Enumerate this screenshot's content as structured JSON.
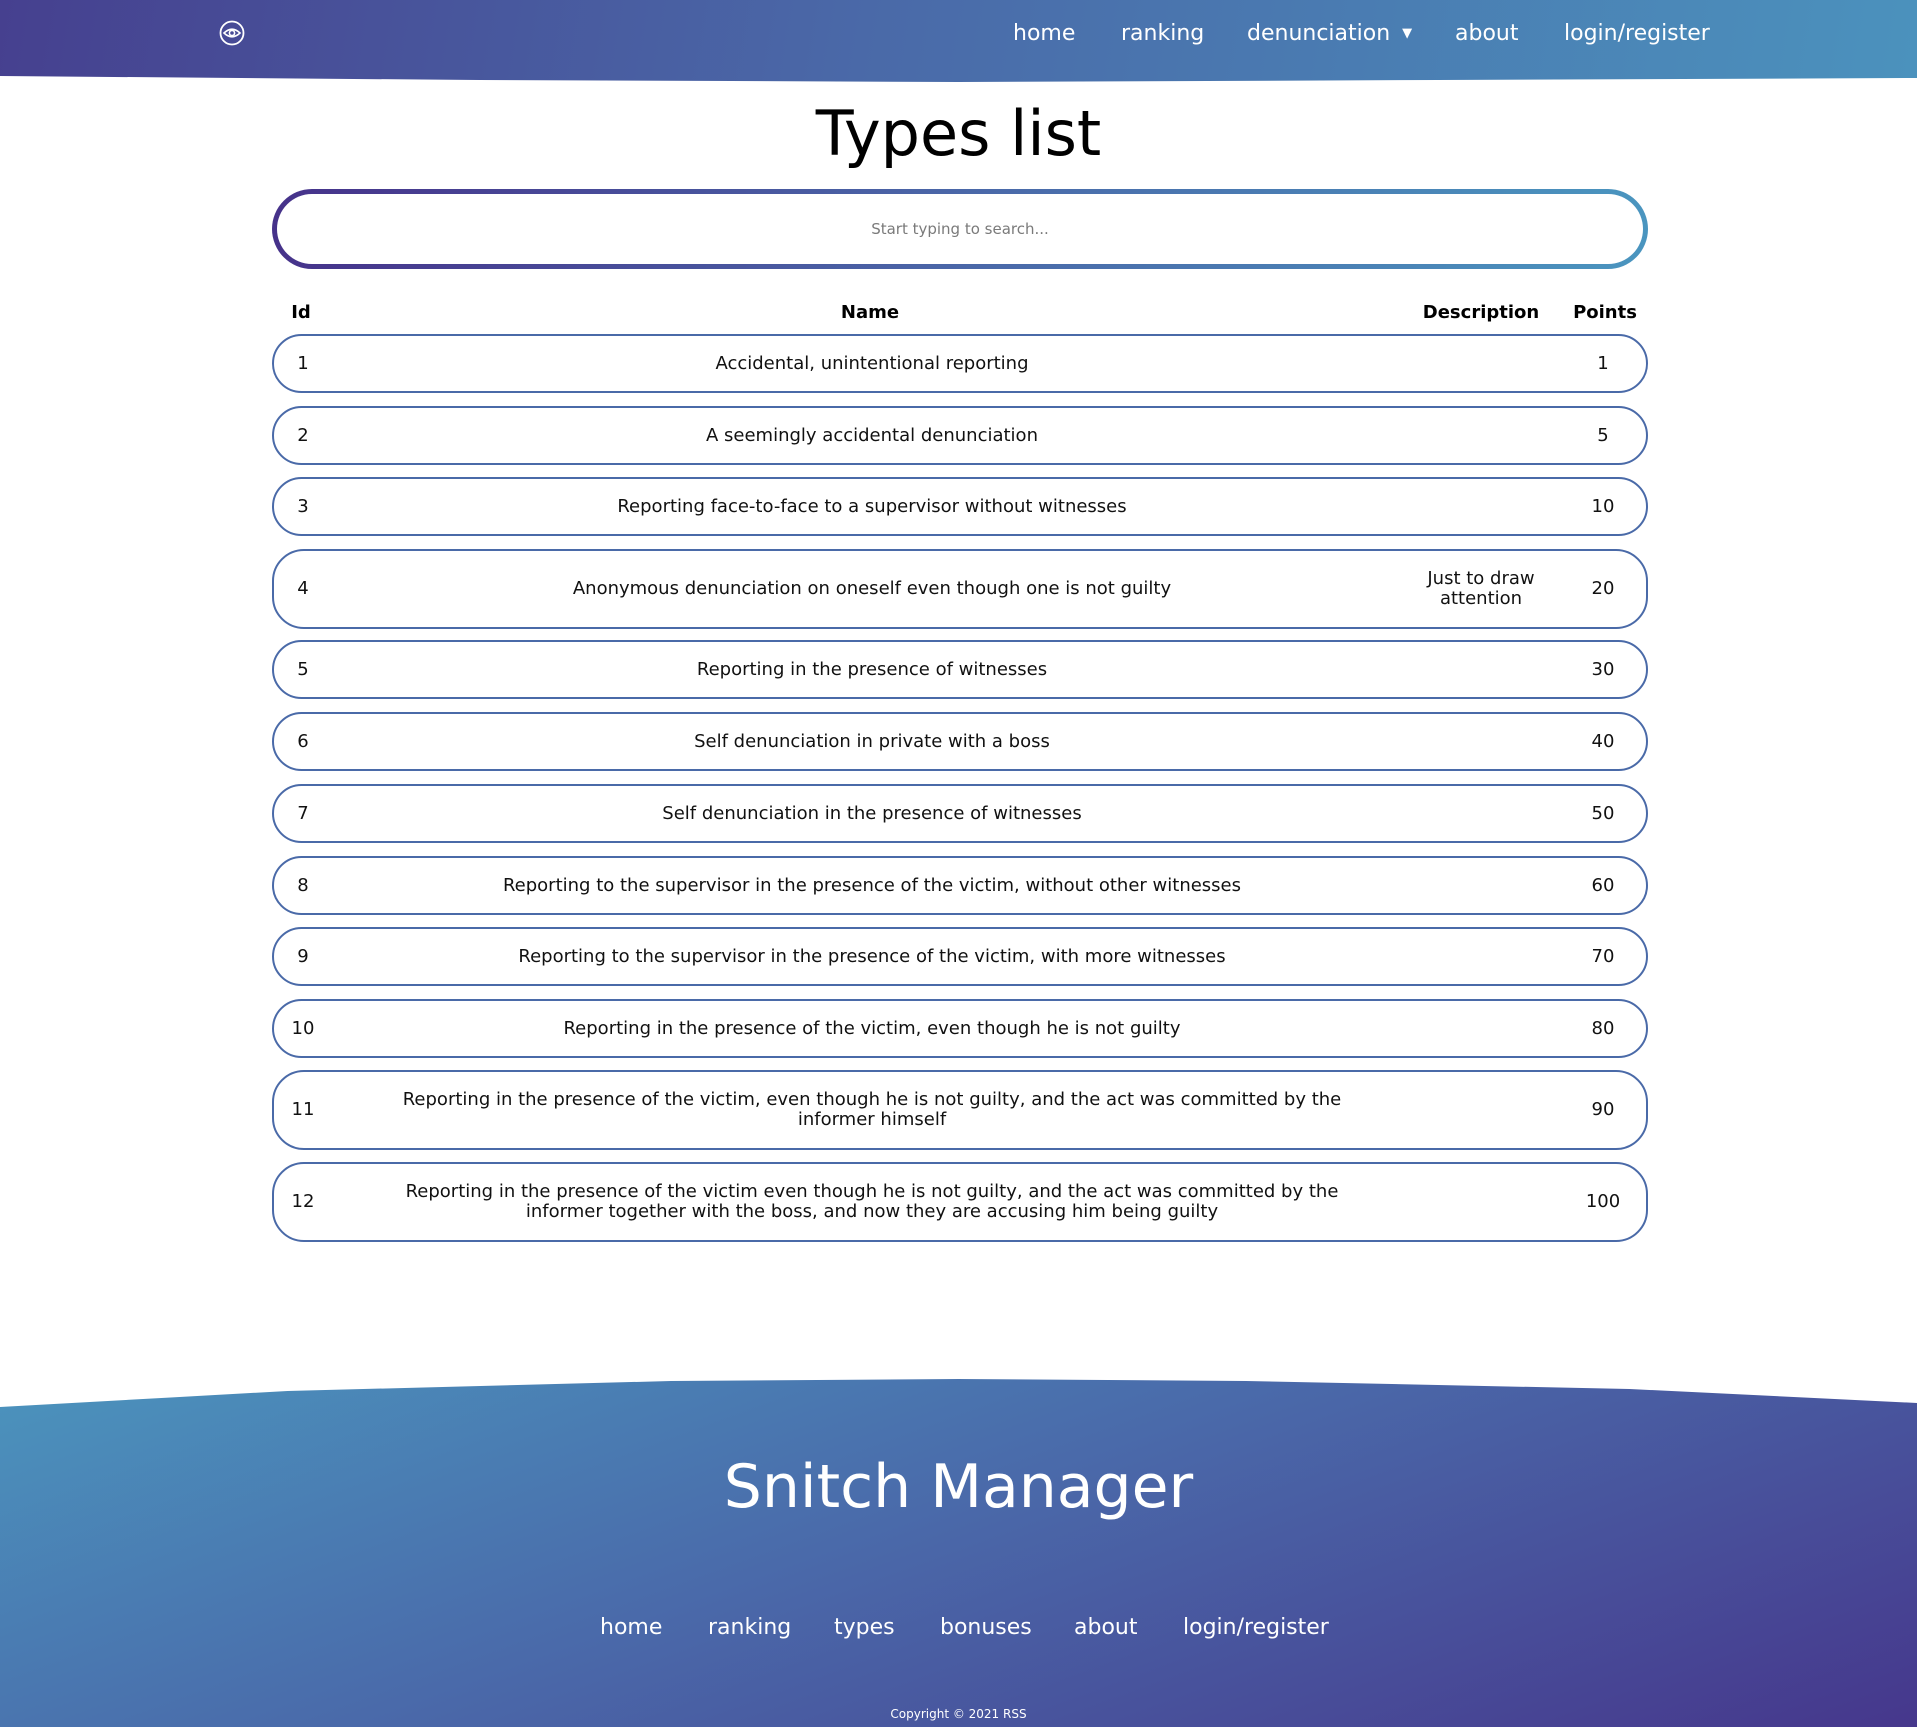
{
  "header": {
    "logo_icon": "eye-icon",
    "nav": [
      {
        "label": "home"
      },
      {
        "label": "ranking"
      },
      {
        "label": "denunciation"
      },
      {
        "label": "about"
      },
      {
        "label": "login/register"
      }
    ],
    "dropdown_icon": "caret-down-icon"
  },
  "main": {
    "title": "Types list",
    "search": {
      "placeholder": "Start typing to search...",
      "value": ""
    },
    "columns": {
      "id": "Id",
      "name": "Name",
      "description": "Description",
      "points": "Points"
    },
    "rows": [
      {
        "id": "1",
        "name": "Accidental, unintentional reporting",
        "description": "",
        "points": "1"
      },
      {
        "id": "2",
        "name": "A seemingly accidental denunciation",
        "description": "",
        "points": "5"
      },
      {
        "id": "3",
        "name": "Reporting face-to-face to a supervisor without witnesses",
        "description": "",
        "points": "10"
      },
      {
        "id": "4",
        "name": "Anonymous denunciation on oneself even though one is not guilty",
        "description": "Just to draw attention",
        "points": "20"
      },
      {
        "id": "5",
        "name": "Reporting in the presence of witnesses",
        "description": "",
        "points": "30"
      },
      {
        "id": "6",
        "name": "Self denunciation in private with a boss",
        "description": "",
        "points": "40"
      },
      {
        "id": "7",
        "name": "Self denunciation in the presence of witnesses",
        "description": "",
        "points": "50"
      },
      {
        "id": "8",
        "name": "Reporting to the supervisor in the presence of the victim, without other witnesses",
        "description": "",
        "points": "60"
      },
      {
        "id": "9",
        "name": "Reporting to the supervisor in the presence of the victim, with more witnesses",
        "description": "",
        "points": "70"
      },
      {
        "id": "10",
        "name": "Reporting in the presence of the victim, even though he is not guilty",
        "description": "",
        "points": "80"
      },
      {
        "id": "11",
        "name": "Reporting in the presence of the victim, even though he is not guilty, and the act was committed by the informer himself",
        "description": "",
        "points": "90"
      },
      {
        "id": "12",
        "name": "Reporting in the presence of the victim even though he is not guilty, and the act was committed by the informer together with the boss, and now they are accusing him being guilty",
        "description": "",
        "points": "100"
      }
    ]
  },
  "footer": {
    "title": "Snitch Manager",
    "nav": [
      {
        "label": "home"
      },
      {
        "label": "ranking"
      },
      {
        "label": "types"
      },
      {
        "label": "bonuses"
      },
      {
        "label": "about"
      },
      {
        "label": "login/register"
      }
    ],
    "copyright": "Copyright © 2021 RSS"
  },
  "colors": {
    "gradient_purple": "#46408f",
    "gradient_blue": "#4b92bd",
    "row_border": "#4a6aa8"
  }
}
